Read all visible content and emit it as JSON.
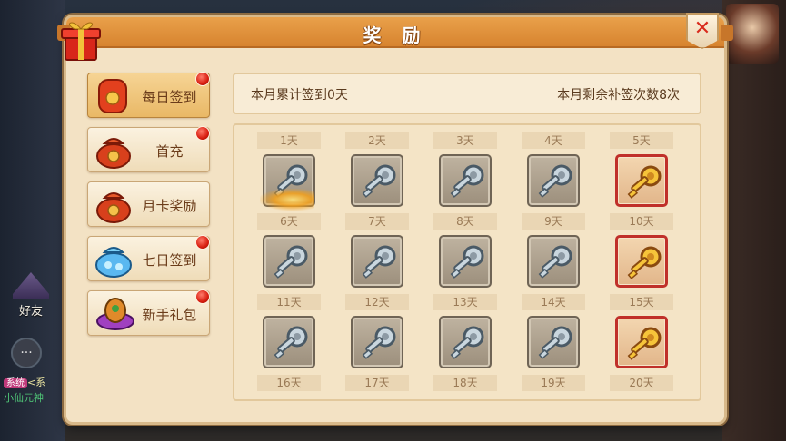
{
  "window": {
    "title": "奖 励",
    "close_label": "✕"
  },
  "menu": [
    {
      "label": "每日签到",
      "icon": "red-envelope-icon",
      "active": true,
      "badge": true
    },
    {
      "label": "首充",
      "icon": "money-bag-icon",
      "active": false,
      "badge": true
    },
    {
      "label": "月卡奖励",
      "icon": "money-bag-icon",
      "active": false,
      "badge": false
    },
    {
      "label": "七日签到",
      "icon": "gem-bag-icon",
      "active": false,
      "badge": true
    },
    {
      "label": "新手礼包",
      "icon": "gift-pouch-icon",
      "active": false,
      "badge": true
    }
  ],
  "signin": {
    "summary_left": "本月累计签到0天",
    "summary_right": "本月剩余补签次数8次",
    "days": [
      {
        "label": "1天",
        "key": "silver"
      },
      {
        "label": "2天",
        "key": "silver"
      },
      {
        "label": "3天",
        "key": "silver"
      },
      {
        "label": "4天",
        "key": "silver"
      },
      {
        "label": "5天",
        "key": "gold"
      },
      {
        "label": "6天",
        "key": "silver"
      },
      {
        "label": "7天",
        "key": "silver"
      },
      {
        "label": "8天",
        "key": "silver"
      },
      {
        "label": "9天",
        "key": "silver"
      },
      {
        "label": "10天",
        "key": "gold"
      },
      {
        "label": "11天",
        "key": "silver"
      },
      {
        "label": "12天",
        "key": "silver"
      },
      {
        "label": "13天",
        "key": "silver"
      },
      {
        "label": "14天",
        "key": "silver"
      },
      {
        "label": "15天",
        "key": "gold"
      },
      {
        "label": "16天",
        "key": "silver"
      },
      {
        "label": "17天",
        "key": "silver"
      },
      {
        "label": "18天",
        "key": "silver"
      },
      {
        "label": "19天",
        "key": "silver"
      },
      {
        "label": "20天",
        "key": "gold"
      }
    ]
  },
  "hud": {
    "friends_label": "好友",
    "chat_icon": "chat-bubble-icon",
    "sys_tag": "系统",
    "sys_prefix": "<系",
    "sys_text": "小仙元神"
  },
  "colors": {
    "title_bar": "#e0913c",
    "panel_bg": "#f3e2c4",
    "badge_red": "#d81e10",
    "gold_border": "#c0302a"
  }
}
